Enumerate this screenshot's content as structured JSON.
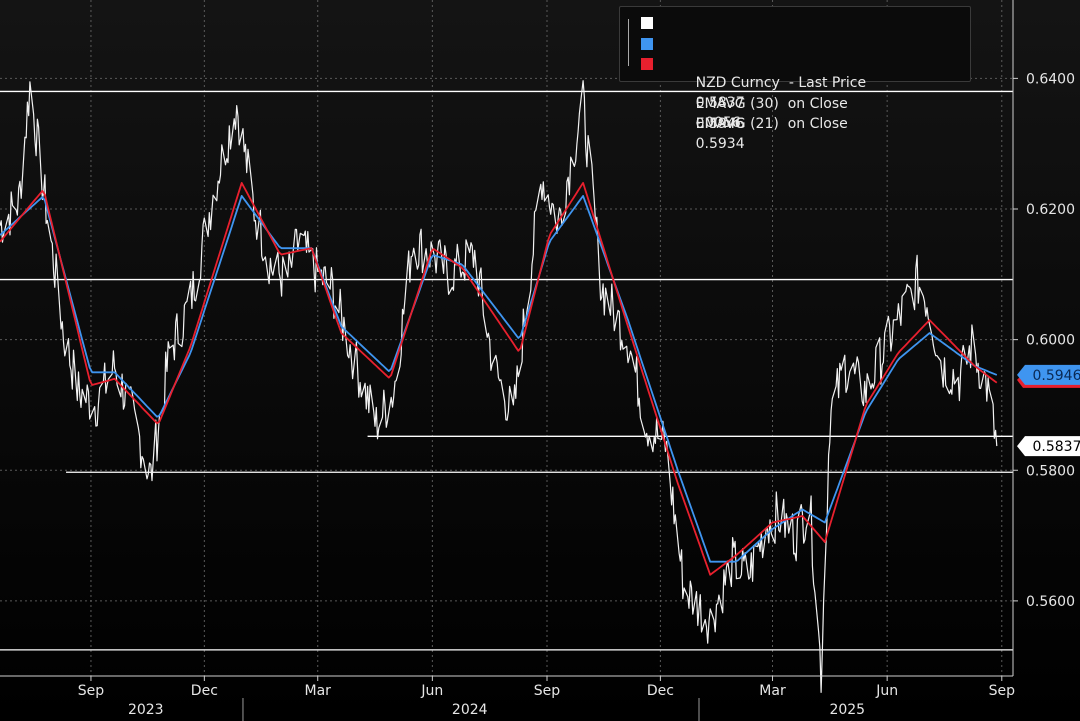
{
  "chart_data": {
    "type": "line",
    "title": "",
    "xlabel": "",
    "ylabel": "",
    "ylim": [
      0.5485,
      0.652
    ],
    "y_ticks": [
      0.64,
      0.62,
      0.6,
      0.58,
      0.56
    ],
    "y_tick_labels": [
      "0.6400",
      "0.6200",
      "0.6000",
      "0.5800",
      "0.5600"
    ],
    "x_range": [
      "2023-06-20",
      "2025-09-10"
    ],
    "month_ticks": [
      {
        "date": "2023-09-01",
        "label": "Sep"
      },
      {
        "date": "2023-12-01",
        "label": "Dec"
      },
      {
        "date": "2024-03-01",
        "label": "Mar"
      },
      {
        "date": "2024-06-01",
        "label": "Jun"
      },
      {
        "date": "2024-09-01",
        "label": "Sep"
      },
      {
        "date": "2024-12-01",
        "label": "Dec"
      },
      {
        "date": "2025-03-01",
        "label": "Mar"
      },
      {
        "date": "2025-06-01",
        "label": "Jun"
      },
      {
        "date": "2025-09-01",
        "label": "Sep"
      }
    ],
    "year_labels": [
      {
        "date": "2023-10-15",
        "label": "2023"
      },
      {
        "date": "2024-07-01",
        "label": "2024"
      },
      {
        "date": "2025-04-30",
        "label": "2025"
      }
    ],
    "year_separators": [
      "2024-01-01",
      "2025-01-01"
    ],
    "grid": true,
    "legend_position": "top-right",
    "legend": [
      {
        "name": "NZD Curncy  - Last Price",
        "value": "0.5837",
        "change": "-.0056",
        "color": "#ffffff"
      },
      {
        "name": "EMAVG (30)  on Close",
        "value": "0.5946",
        "color": "#3f95f0"
      },
      {
        "name": "EMAVG (21)  on Close",
        "value": "0.5934",
        "color": "#e8202e"
      }
    ],
    "price_anchors": [
      [
        "2023-06-20",
        0.6175
      ],
      [
        "2023-07-05",
        0.621
      ],
      [
        "2023-07-14",
        0.639
      ],
      [
        "2023-07-25",
        0.623
      ],
      [
        "2023-08-10",
        0.601
      ],
      [
        "2023-08-22",
        0.592
      ],
      [
        "2023-09-05",
        0.59
      ],
      [
        "2023-09-20",
        0.596
      ],
      [
        "2023-10-05",
        0.588
      ],
      [
        "2023-10-19",
        0.579
      ],
      [
        "2023-11-03",
        0.598
      ],
      [
        "2023-11-20",
        0.606
      ],
      [
        "2023-12-10",
        0.624
      ],
      [
        "2023-12-27",
        0.636
      ],
      [
        "2024-01-10",
        0.62
      ],
      [
        "2024-01-24",
        0.611
      ],
      [
        "2024-02-05",
        0.609
      ],
      [
        "2024-02-15",
        0.615
      ],
      [
        "2024-03-01",
        0.61
      ],
      [
        "2024-03-12",
        0.608
      ],
      [
        "2024-04-01",
        0.596
      ],
      [
        "2024-04-17",
        0.587
      ],
      [
        "2024-05-01",
        0.592
      ],
      [
        "2024-05-16",
        0.615
      ],
      [
        "2024-06-01",
        0.613
      ],
      [
        "2024-06-15",
        0.61
      ],
      [
        "2024-07-05",
        0.613
      ],
      [
        "2024-07-20",
        0.596
      ],
      [
        "2024-08-05",
        0.588
      ],
      [
        "2024-08-15",
        0.605
      ],
      [
        "2024-08-28",
        0.625
      ],
      [
        "2024-09-10",
        0.618
      ],
      [
        "2024-09-30",
        0.636
      ],
      [
        "2024-10-15",
        0.608
      ],
      [
        "2024-11-05",
        0.6
      ],
      [
        "2024-11-20",
        0.587
      ],
      [
        "2024-12-05",
        0.584
      ],
      [
        "2024-12-20",
        0.562
      ],
      [
        "2025-01-10",
        0.557
      ],
      [
        "2025-01-28",
        0.566
      ],
      [
        "2025-02-10",
        0.564
      ],
      [
        "2025-02-25",
        0.572
      ],
      [
        "2025-03-05",
        0.573
      ],
      [
        "2025-03-20",
        0.57
      ],
      [
        "2025-03-31",
        0.575
      ],
      [
        "2025-04-09",
        0.549
      ],
      [
        "2025-04-16",
        0.588
      ],
      [
        "2025-04-28",
        0.596
      ],
      [
        "2025-05-15",
        0.592
      ],
      [
        "2025-06-05",
        0.601
      ],
      [
        "2025-06-25",
        0.609
      ],
      [
        "2025-07-03",
        0.606
      ],
      [
        "2025-07-15",
        0.596
      ],
      [
        "2025-07-29",
        0.594
      ],
      [
        "2025-08-08",
        0.599
      ],
      [
        "2025-08-20",
        0.593
      ],
      [
        "2025-08-28",
        0.5837
      ]
    ],
    "ema30_anchors": [
      [
        "2023-06-20",
        0.616
      ],
      [
        "2023-07-25",
        0.622
      ],
      [
        "2023-09-01",
        0.595
      ],
      [
        "2023-09-20",
        0.595
      ],
      [
        "2023-10-25",
        0.588
      ],
      [
        "2023-11-20",
        0.598
      ],
      [
        "2023-12-31",
        0.622
      ],
      [
        "2024-01-31",
        0.614
      ],
      [
        "2024-02-25",
        0.614
      ],
      [
        "2024-03-20",
        0.602
      ],
      [
        "2024-04-28",
        0.595
      ],
      [
        "2024-06-01",
        0.613
      ],
      [
        "2024-06-25",
        0.6115
      ],
      [
        "2024-08-10",
        0.6
      ],
      [
        "2024-09-03",
        0.615
      ],
      [
        "2024-09-30",
        0.622
      ],
      [
        "2024-11-05",
        0.603
      ],
      [
        "2024-12-15",
        0.58
      ],
      [
        "2025-01-10",
        0.566
      ],
      [
        "2025-01-31",
        0.566
      ],
      [
        "2025-03-01",
        0.571
      ],
      [
        "2025-03-25",
        0.574
      ],
      [
        "2025-04-12",
        0.572
      ],
      [
        "2025-05-15",
        0.589
      ],
      [
        "2025-06-10",
        0.597
      ],
      [
        "2025-07-05",
        0.601
      ],
      [
        "2025-08-10",
        0.596
      ],
      [
        "2025-08-28",
        0.5946
      ]
    ],
    "ema21_anchors": [
      [
        "2023-06-20",
        0.615
      ],
      [
        "2023-07-25",
        0.623
      ],
      [
        "2023-09-01",
        0.593
      ],
      [
        "2023-09-20",
        0.594
      ],
      [
        "2023-10-25",
        0.587
      ],
      [
        "2023-11-20",
        0.599
      ],
      [
        "2023-12-31",
        0.624
      ],
      [
        "2024-01-31",
        0.613
      ],
      [
        "2024-02-25",
        0.614
      ],
      [
        "2024-03-20",
        0.601
      ],
      [
        "2024-04-28",
        0.594
      ],
      [
        "2024-06-01",
        0.614
      ],
      [
        "2024-06-25",
        0.611
      ],
      [
        "2024-08-10",
        0.598
      ],
      [
        "2024-09-03",
        0.616
      ],
      [
        "2024-09-30",
        0.624
      ],
      [
        "2024-11-05",
        0.602
      ],
      [
        "2024-12-15",
        0.578
      ],
      [
        "2025-01-10",
        0.564
      ],
      [
        "2025-01-31",
        0.567
      ],
      [
        "2025-03-01",
        0.572
      ],
      [
        "2025-03-25",
        0.573
      ],
      [
        "2025-04-12",
        0.569
      ],
      [
        "2025-05-15",
        0.59
      ],
      [
        "2025-06-10",
        0.598
      ],
      [
        "2025-07-05",
        0.603
      ],
      [
        "2025-08-10",
        0.596
      ],
      [
        "2025-08-28",
        0.5934
      ]
    ],
    "price_noise": 0.0018,
    "support_resistance_lines": [
      {
        "level": 0.638,
        "from": "2023-06-20",
        "to": "2025-09-10"
      },
      {
        "level": 0.6092,
        "from": "2023-06-20",
        "to": "2025-09-10"
      },
      {
        "level": 0.5852,
        "from": "2024-04-10",
        "to": "2025-09-10"
      },
      {
        "level": 0.5797,
        "from": "2023-08-12",
        "to": "2025-09-10"
      },
      {
        "level": 0.5525,
        "from": "2023-06-20",
        "to": "2025-09-10"
      }
    ],
    "last_value_tags": [
      {
        "label": "0.5946",
        "value": 0.5946,
        "color": "#3f95f0",
        "text_color": "#0a2a55"
      },
      {
        "label": "0.5837",
        "value": 0.5837,
        "color": "#ffffff",
        "text_color": "#000000"
      }
    ]
  }
}
